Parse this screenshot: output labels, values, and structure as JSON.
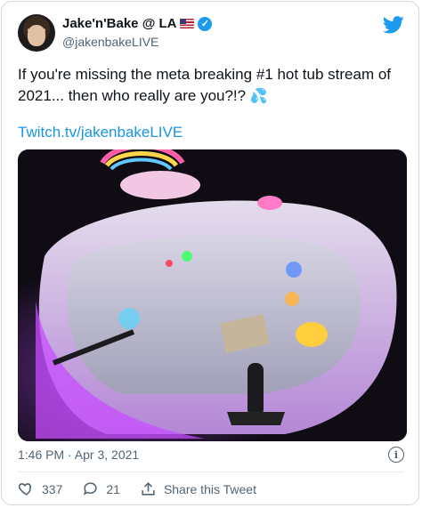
{
  "author": {
    "name": "Jake'n'Bake @ LA",
    "handle": "@jakenbakeLIVE",
    "flag_icon": "us-flag-icon",
    "verified_icon": "verified-badge-icon"
  },
  "tweet": {
    "text": "If you're missing the meta breaking #1 hot tub stream of 2021... then who really are you?!?",
    "emoji": "💦",
    "link": "Twitch.tv/jakenbakeLIVE"
  },
  "media": {
    "icon": "photo-hot-tub"
  },
  "meta": {
    "timestamp": "1:46 PM · Apr 3, 2021"
  },
  "actions": {
    "likes": "337",
    "replies": "21",
    "share_label": "Share this Tweet"
  },
  "colors": {
    "accent": "#1d9bf0",
    "secondary_text": "#536471",
    "link": "#1b95e0"
  }
}
